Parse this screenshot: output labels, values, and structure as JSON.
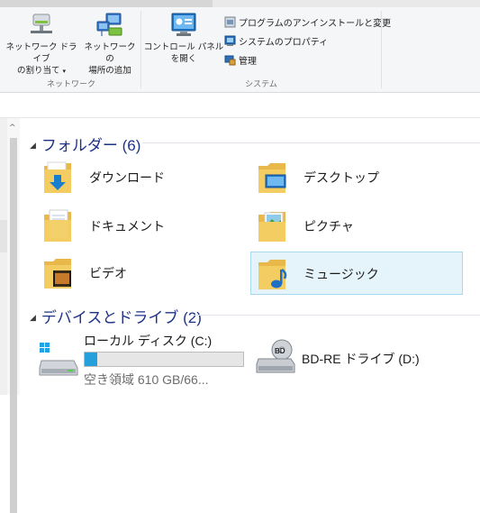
{
  "ribbon": {
    "network_group": {
      "label": "ネットワーク",
      "map_drive": {
        "line1": "ネットワーク ドライブ",
        "line2": "の割り当て",
        "caret": "▾"
      },
      "add_location": {
        "line1": "ネットワークの",
        "line2": "場所の追加"
      }
    },
    "system_group": {
      "label": "システム",
      "control_panel": {
        "line1": "コントロール パネル",
        "line2": "を開く"
      },
      "uninstall": "プログラムのアンインストールと変更",
      "system_properties": "システムのプロパティ",
      "manage": "管理"
    }
  },
  "nav": {
    "scroll_up": "^"
  },
  "sections": {
    "folders": {
      "toggle": "◢",
      "title": "フォルダー (6)",
      "items": [
        {
          "label": "ダウンロード",
          "icon": "downloads-folder-icon"
        },
        {
          "label": "デスクトップ",
          "icon": "desktop-folder-icon"
        },
        {
          "label": "ドキュメント",
          "icon": "documents-folder-icon"
        },
        {
          "label": "ピクチャ",
          "icon": "pictures-folder-icon"
        },
        {
          "label": "ビデオ",
          "icon": "videos-folder-icon"
        },
        {
          "label": "ミュージック",
          "icon": "music-folder-icon"
        }
      ]
    },
    "devices": {
      "toggle": "◢",
      "title": "デバイスとドライブ (2)",
      "drives": [
        {
          "name": "ローカル ディスク (C:)",
          "free": "空き領域 610 GB/66...",
          "used_fraction": 0.08,
          "icon": "local-disk-icon"
        },
        {
          "name": "BD-RE ドライブ (D:)",
          "icon": "bd-drive-icon"
        }
      ]
    }
  },
  "colors": {
    "accent": "#1e3287",
    "usage_bar": "#26a0da",
    "selection_bg": "#e5f3fb",
    "selection_border": "#a8d8f0",
    "folder": "#f3cd62"
  }
}
